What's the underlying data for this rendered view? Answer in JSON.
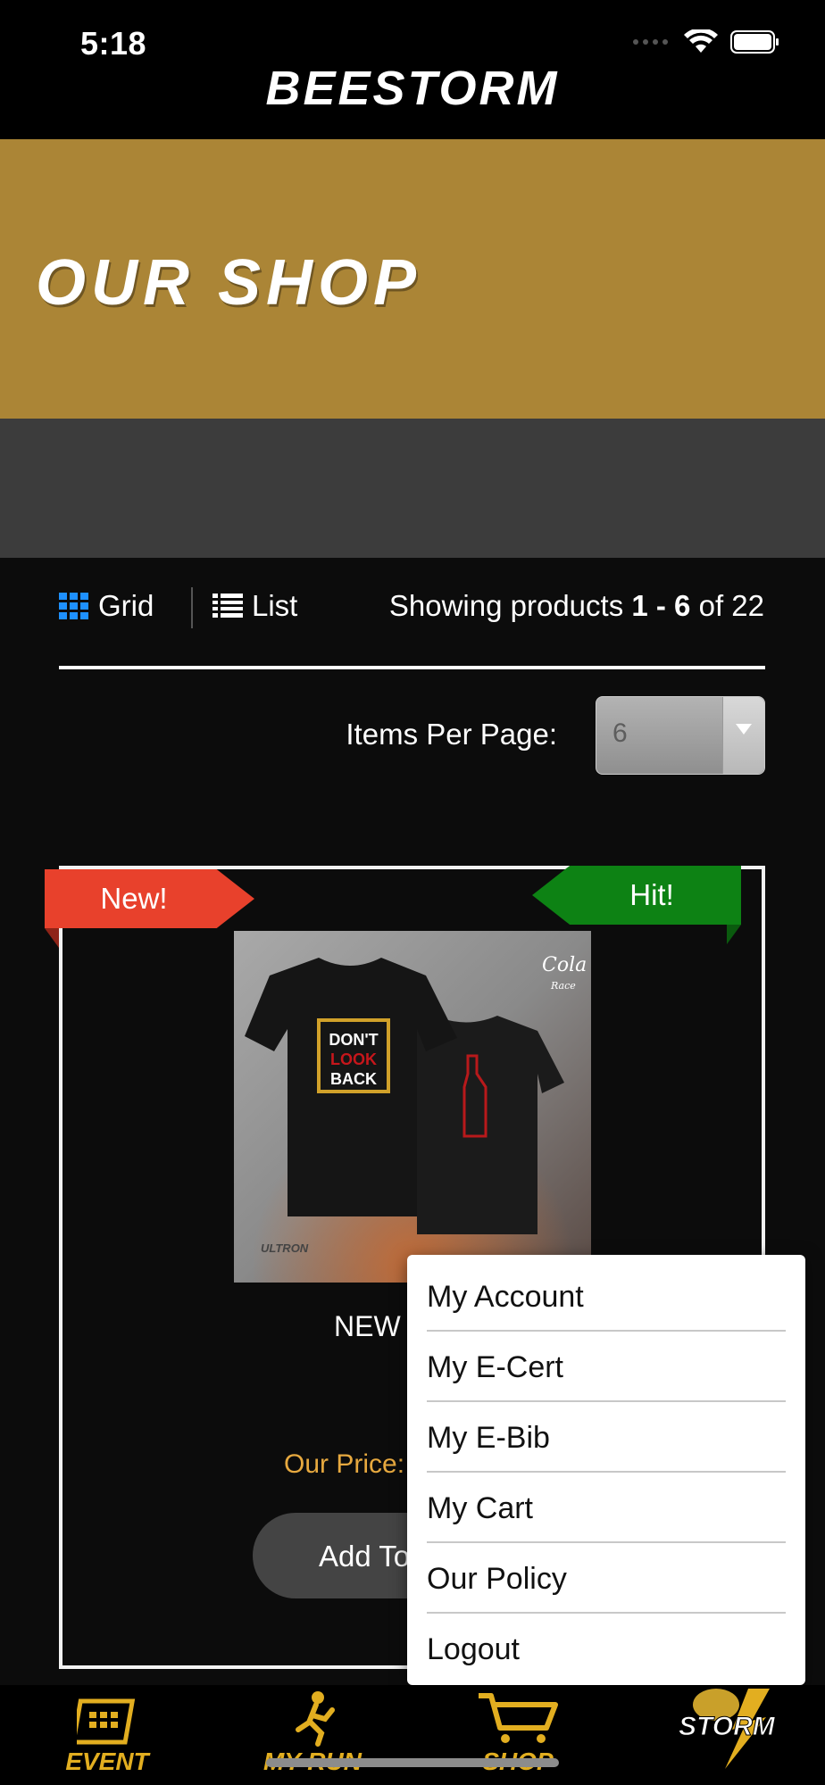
{
  "status_bar": {
    "time": "5:18"
  },
  "header": {
    "brand": "BEESTORM"
  },
  "banner": {
    "title": "OUR SHOP",
    "color": "#ab8536"
  },
  "toolbar": {
    "grid_label": "Grid",
    "list_label": "List",
    "showing_prefix": "Showing products ",
    "showing_range": "1 - 6",
    "showing_mid": " of ",
    "showing_total": "22",
    "items_per_page_label": "Items Per Page:",
    "items_per_page_value": "6"
  },
  "product": {
    "badge_new": "New!",
    "badge_hit": "Hit!",
    "name_visible": "NEW",
    "price_label_visible": "Our Price:",
    "add_button_visible": "Add To",
    "image_texts": {
      "shirt_front": "DON'T LOOK BACK",
      "brand_mark": "ULTRON",
      "logo": "The Cola Race"
    }
  },
  "menu": {
    "items": [
      "My Account",
      "My E-Cert",
      "My E-Bib",
      "My Cart",
      "Our Policy",
      "Logout"
    ]
  },
  "tabbar": {
    "tabs": [
      {
        "label": "EVENT",
        "icon": "calendar-icon"
      },
      {
        "label": "MY RUN",
        "icon": "runner-icon"
      },
      {
        "label": "SHOP",
        "icon": "cart-icon"
      },
      {
        "label": "BEE STORM",
        "icon": "bee-logo-icon"
      }
    ]
  },
  "colors": {
    "accent": "#e7a93f",
    "ribbon_new": "#e8412c",
    "ribbon_hit": "#0d8214",
    "tab_label": "#e2ae20"
  }
}
